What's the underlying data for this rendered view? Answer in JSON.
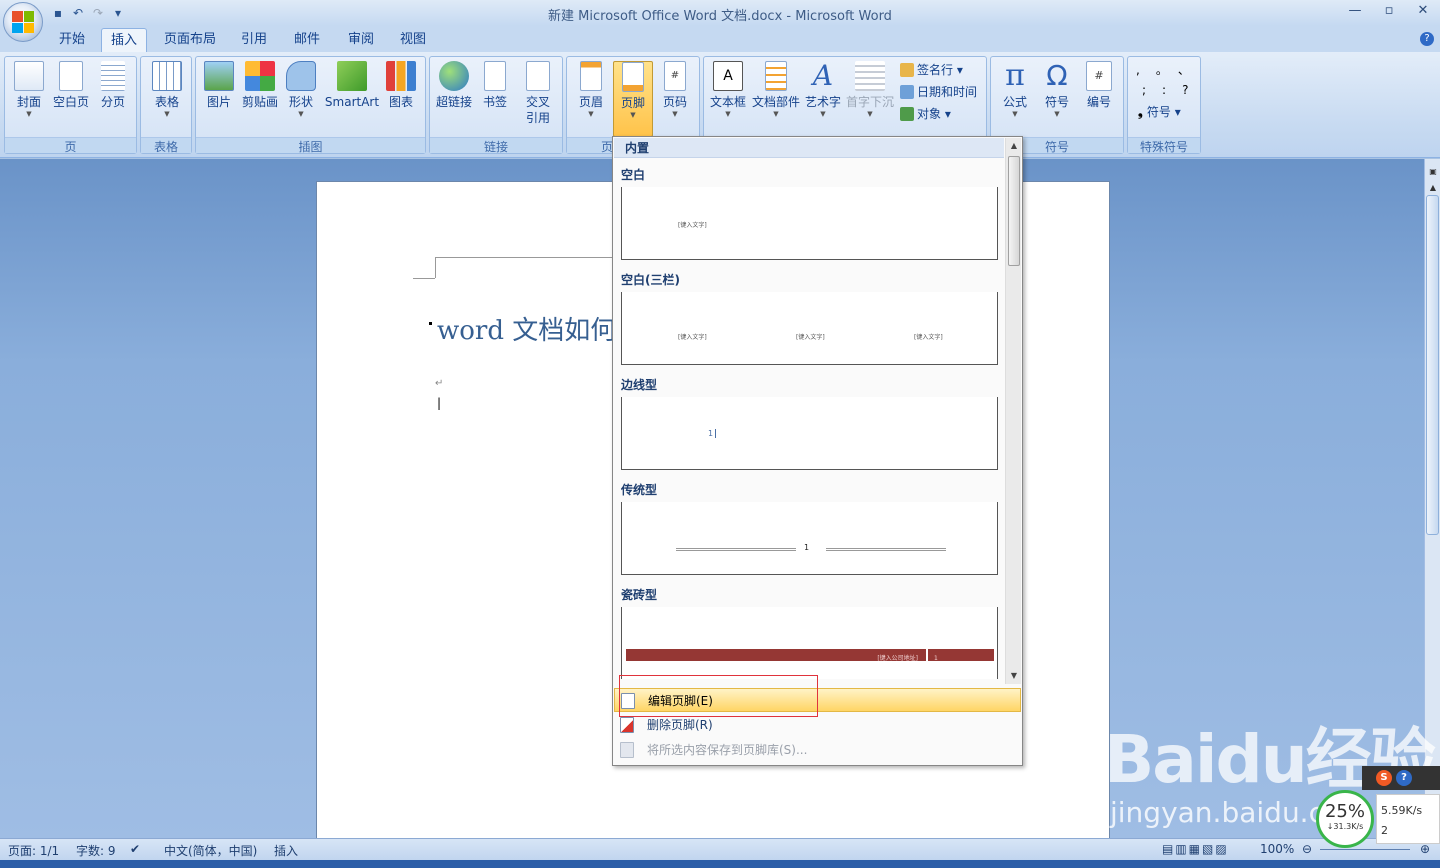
{
  "window": {
    "title": "新建 Microsoft Office Word 文档.docx - Microsoft Word",
    "controls": [
      "—",
      "▫",
      "✕"
    ]
  },
  "quick_access": [
    "save-icon",
    "undo-icon",
    "redo-icon",
    "customize-icon"
  ],
  "tabs": [
    "开始",
    "插入",
    "页面布局",
    "引用",
    "邮件",
    "审阅",
    "视图"
  ],
  "active_tab": "插入",
  "ribbon": {
    "groups": {
      "pages": "页",
      "tables": "表格",
      "illustrations": "插图",
      "links": "链接",
      "header_footer": "页",
      "text": "",
      "symbols": "符号",
      "special_symbols": "特殊符号"
    },
    "buttons": {
      "cover": "封面",
      "blank_page": "空白页",
      "page_break": "分页",
      "table": "表格",
      "picture": "图片",
      "clip_art": "剪贴画",
      "shapes": "形状",
      "smartart": "SmartArt",
      "chart": "图表",
      "hyperlink": "超链接",
      "bookmark": "书签",
      "cross_ref_1": "交叉",
      "cross_ref_2": "引用",
      "header": "页眉",
      "footer": "页脚",
      "page_number": "页码",
      "textbox": "文本框",
      "quick_parts": "文档部件",
      "wordart": "艺术字",
      "drop_cap": "首字下沉",
      "signature_line": "签名行",
      "date_time": "日期和时间",
      "object": "对象",
      "equation": "公式",
      "symbol": "符号",
      "numbering": "编号",
      "special_symbol": "符号"
    },
    "special_chars": [
      ",",
      "。",
      "、",
      ";",
      ":",
      "?"
    ]
  },
  "document": {
    "heading": "word 文档如何",
    "para_mark": "↵"
  },
  "footer_menu": {
    "section_title": "内置",
    "items": [
      {
        "name": "空白",
        "placeholders": [
          "[键入文字]"
        ]
      },
      {
        "name": "空白(三栏)",
        "placeholders": [
          "[键入文字]",
          "[键入文字]",
          "[键入文字]"
        ]
      },
      {
        "name": "边线型",
        "placeholders": [
          "1"
        ]
      },
      {
        "name": "传统型",
        "placeholders": [
          "1"
        ]
      },
      {
        "name": "瓷砖型",
        "placeholders": [
          "[键入公司地址]",
          "1"
        ]
      }
    ],
    "commands": {
      "edit": "编辑页脚(E)",
      "remove": "删除页脚(R)",
      "save": "将所选内容保存到页脚库(S)..."
    }
  },
  "statusbar": {
    "page": "页面: 1/1",
    "words": "字数: 9",
    "language": "中文(简体，中国)",
    "mode": "插入",
    "zoom": "100%"
  },
  "overlay": {
    "watermark": "Baidu经验",
    "watermark_url": "jingyan.baidu.com",
    "net_percent": "25%",
    "net_down_circle": "↓31.3K/s",
    "net_up": "5.59K/s",
    "net_count": "2"
  },
  "colors": {
    "ribbon_bg": "#c7daf1",
    "active_button": "#ffc34a",
    "highlight_box": "#e0333c",
    "heading_text": "#365f91"
  }
}
